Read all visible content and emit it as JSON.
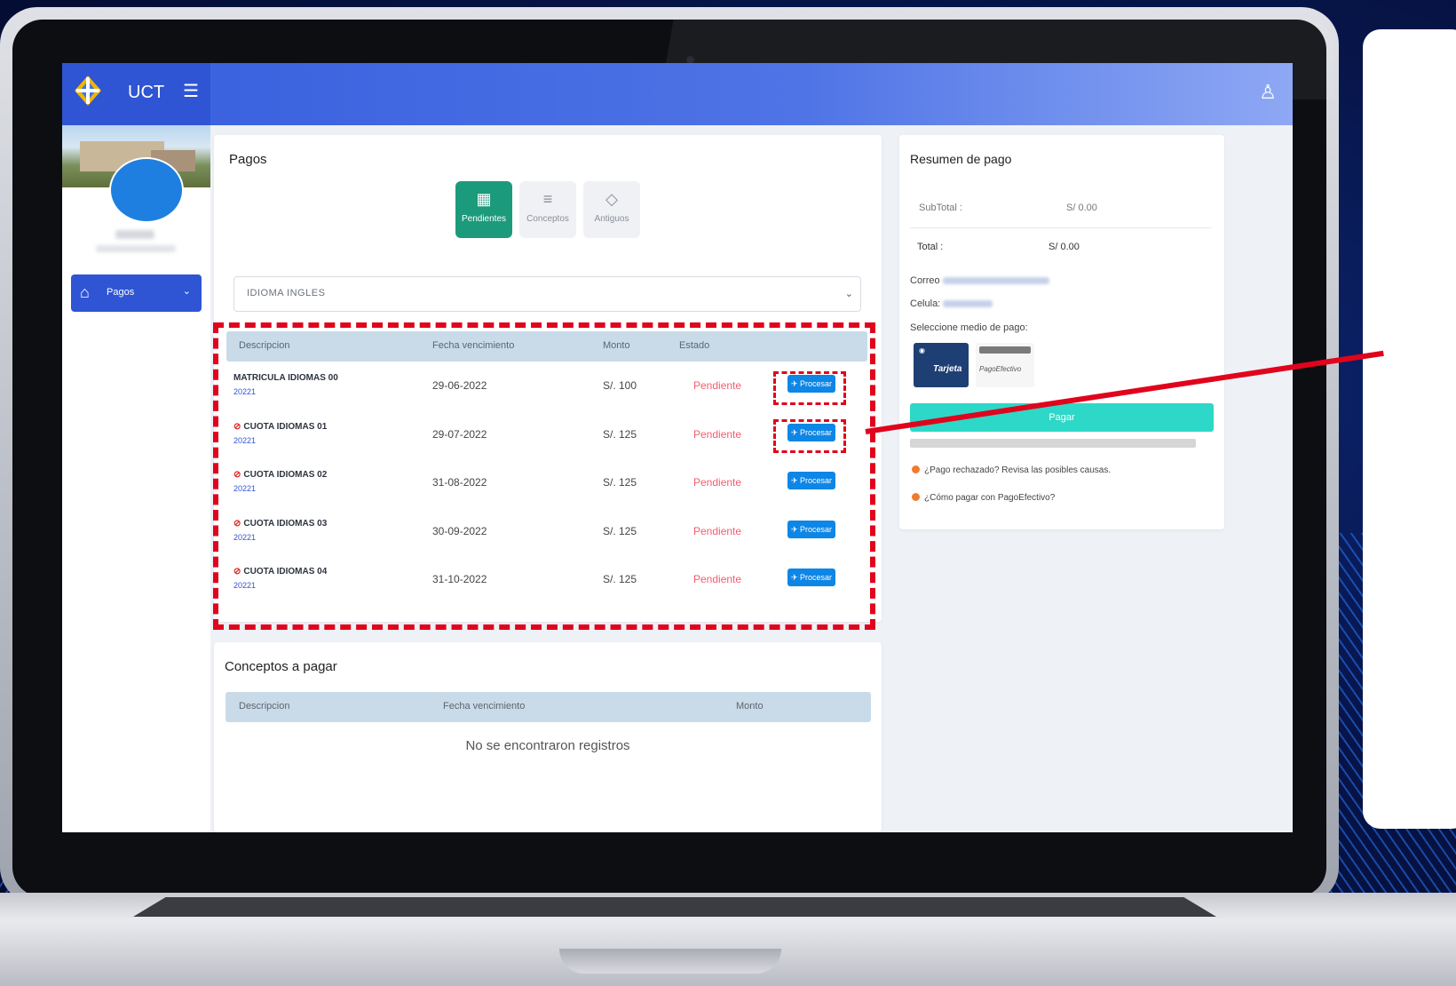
{
  "app": {
    "brand": "UCT"
  },
  "sidebar": {
    "items": [
      {
        "label": "Pagos"
      }
    ]
  },
  "pagos": {
    "title": "Pagos",
    "tabs": [
      {
        "label": "Pendientes",
        "icon": "grid-icon",
        "active": true
      },
      {
        "label": "Conceptos",
        "icon": "list-icon",
        "active": false
      },
      {
        "label": "Antiguos",
        "icon": "tag-icon",
        "active": false
      }
    ],
    "select_value": "IDIOMA INGLES",
    "table": {
      "headers": [
        "Descripcion",
        "Fecha vencimiento",
        "Monto",
        "Estado"
      ],
      "rows": [
        {
          "desc": "MATRICULA IDIOMAS 00",
          "period": "20221",
          "fecha": "29-06-2022",
          "monto": "S/. 100",
          "estado": "Pendiente",
          "action": "Procesar",
          "blocked": false
        },
        {
          "desc": "CUOTA IDIOMAS 01",
          "period": "20221",
          "fecha": "29-07-2022",
          "monto": "S/. 125",
          "estado": "Pendiente",
          "action": "Procesar",
          "blocked": true
        },
        {
          "desc": "CUOTA IDIOMAS 02",
          "period": "20221",
          "fecha": "31-08-2022",
          "monto": "S/. 125",
          "estado": "Pendiente",
          "action": "Procesar",
          "blocked": true
        },
        {
          "desc": "CUOTA IDIOMAS 03",
          "period": "20221",
          "fecha": "30-09-2022",
          "monto": "S/. 125",
          "estado": "Pendiente",
          "action": "Procesar",
          "blocked": true
        },
        {
          "desc": "CUOTA IDIOMAS 04",
          "period": "20221",
          "fecha": "31-10-2022",
          "monto": "S/. 125",
          "estado": "Pendiente",
          "action": "Procesar",
          "blocked": true
        }
      ]
    }
  },
  "conceptos": {
    "title": "Conceptos a pagar",
    "headers": [
      "Descripcion",
      "Fecha vencimiento",
      "Monto"
    ],
    "empty": "No se encontraron registros"
  },
  "resumen": {
    "title": "Resumen de pago",
    "subtotal_label": "SubTotal :",
    "subtotal_value": "S/ 0.00",
    "total_label": "Total :",
    "total_value": "S/ 0.00",
    "correo_label": "Correo",
    "celular_label": "Celula:",
    "medio_label": "Seleccione medio de pago:",
    "tarjeta_label": "Tarjeta",
    "pagoefectivo_label": "PagoEfectivo",
    "pagar_label": "Pagar",
    "link1": "¿Pago rechazado? Revisa las posibles causas.",
    "link2": "¿Cómo pagar con PagoEfectivo?"
  },
  "colors": {
    "accent": "#2f55d4",
    "active_tab": "#1c9a7c",
    "pending": "#f25c6e",
    "process_button": "#0e86e6",
    "pay_button": "#2dd8c8",
    "highlight": "#e0041c"
  }
}
